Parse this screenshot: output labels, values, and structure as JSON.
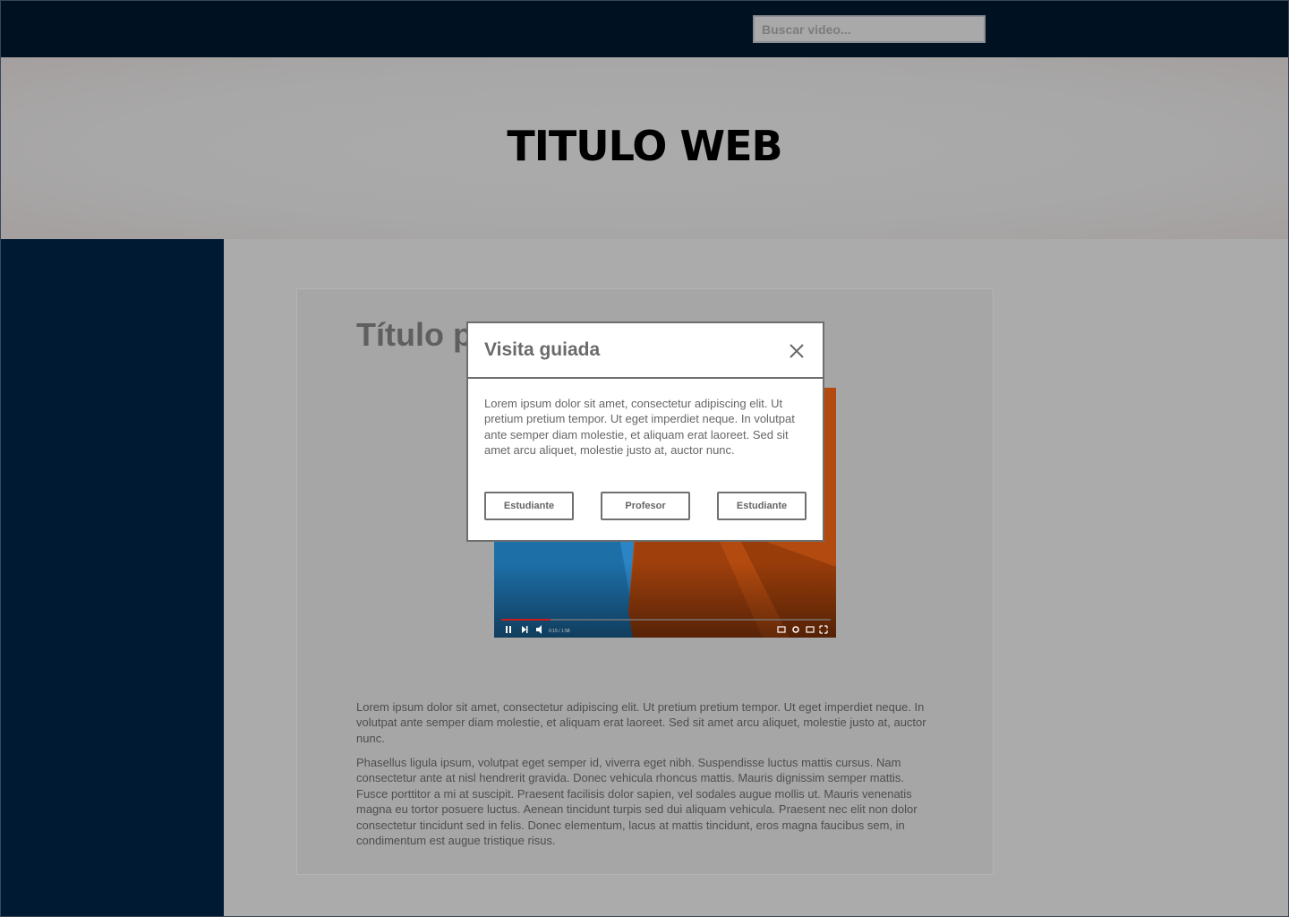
{
  "header": {
    "search_placeholder": "Buscar video..."
  },
  "hero": {
    "title": "TITULO WEB"
  },
  "content": {
    "title": "Título p",
    "paragraphs": [
      "Lorem ipsum dolor sit amet, consectetur adipiscing elit. Ut pretium pretium tempor. Ut eget imperdiet neque. In volutpat ante semper diam molestie, et aliquam erat laoreet. Sed sit amet arcu aliquet, molestie justo at, auctor nunc.",
      "Phasellus ligula ipsum, volutpat eget semper id, viverra eget nibh. Suspendisse luctus mattis cursus. Nam consectetur ante at nisl hendrerit gravida. Donec vehicula rhoncus mattis. Mauris dignissim semper mattis. Fusce porttitor a mi at suscipit. Praesent facilisis dolor sapien, vel sodales augue mollis ut. Mauris venenatis magna eu tortor posuere luctus. Aenean tincidunt turpis sed dui aliquam vehicula. Praesent nec elit non dolor consectetur tincidunt sed in felis. Donec elementum, lacus at mattis tincidunt, eros magna faucibus sem, in condimentum est augue tristique risus."
    ],
    "video": {
      "time": "0:15 / 1:58",
      "progress": 0.15,
      "icons": [
        "pause-icon",
        "next-icon",
        "volume-icon",
        "captions-icon",
        "settings-icon",
        "theater-icon",
        "fullscreen-icon"
      ]
    }
  },
  "modal": {
    "title": "Visita guiada",
    "text": "Lorem ipsum dolor sit amet, consectetur adipiscing elit. Ut pretium pretium tempor. Ut eget imperdiet neque. In volutpat ante semper diam molestie, et aliquam erat laoreet. Sed sit amet arcu aliquet, molestie justo at, auctor nunc.",
    "buttons": [
      "Estudiante",
      "Profesor",
      "Estudiante"
    ]
  },
  "colors": {
    "topbar": "#001122",
    "sidebar": "#001a33",
    "overlay": "#ababab",
    "video_blue": "#1d6fa8",
    "video_orange": "#b34a0f",
    "progress_red": "#cc1b1b"
  }
}
